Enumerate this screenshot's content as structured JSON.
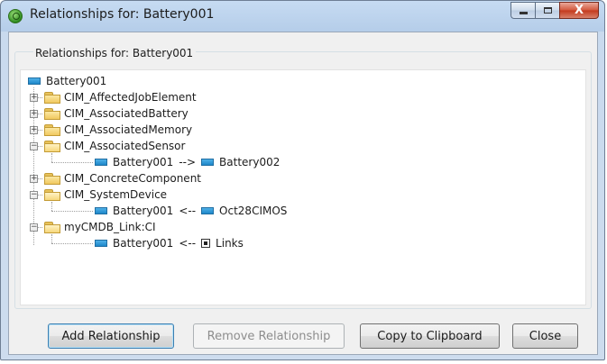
{
  "window": {
    "title": "Relationships for: Battery001",
    "controls": {
      "minimize": "minimize",
      "maximize": "maximize",
      "close": "X"
    }
  },
  "group": {
    "label": "Relationships for: Battery001"
  },
  "tree": {
    "root": "Battery001",
    "nodes": [
      {
        "label": "CIM_AffectedJobElement",
        "expanded": false
      },
      {
        "label": "CIM_AssociatedBattery",
        "expanded": false
      },
      {
        "label": "CIM_AssociatedMemory",
        "expanded": false
      },
      {
        "label": "CIM_AssociatedSensor",
        "expanded": true,
        "child": {
          "source": "Battery001",
          "arrow": "-->",
          "target": "Battery002",
          "target_icon": "object-icon"
        }
      },
      {
        "label": "CIM_ConcreteComponent",
        "expanded": false
      },
      {
        "label": "CIM_SystemDevice",
        "expanded": true,
        "child": {
          "source": "Battery001",
          "arrow": "<--",
          "target": "Oct28CIMOS",
          "target_icon": "object-icon"
        }
      },
      {
        "label": "myCMDB_Link:CI",
        "expanded": true,
        "child": {
          "source": "Battery001",
          "arrow": "<--",
          "target": "Links",
          "target_icon": "link-icon"
        }
      }
    ]
  },
  "buttons": {
    "add": "Add Relationship",
    "remove": "Remove Relationship",
    "copy": "Copy to Clipboard",
    "close": "Close"
  },
  "colors": {
    "object_icon": "#1d87c9",
    "folder": "#f1c960",
    "titlebar": "#b5cde9"
  }
}
